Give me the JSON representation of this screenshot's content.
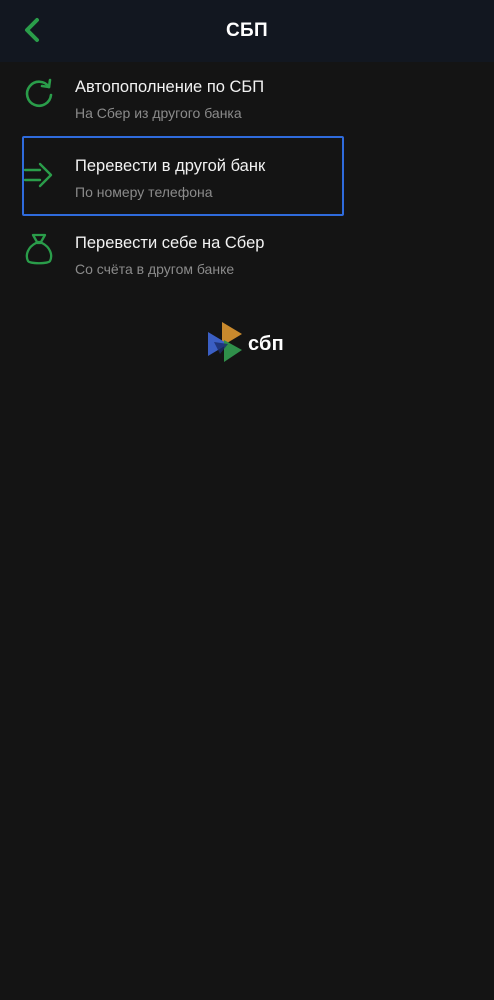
{
  "header": {
    "title": "СБП",
    "back_icon": "chevron-left-icon"
  },
  "menu": {
    "items": [
      {
        "title": "Автопополнение по СБП",
        "subtitle": "На Сбер из другого банка",
        "icon": "refresh-icon"
      },
      {
        "title": "Перевести в другой банк",
        "subtitle": "По номеру телефона",
        "icon": "transfer-arrow-icon"
      },
      {
        "title": "Перевести себе на Сбер",
        "subtitle": "Со счёта в другом банке",
        "icon": "money-bag-icon"
      }
    ]
  },
  "logo": {
    "text": "сбп",
    "icon": "sbp-logo-icon"
  },
  "colors": {
    "accent_green": "#2a9d4a",
    "focus_blue": "#2f6bdc",
    "background": "#141414",
    "header_background": "#121720",
    "subtitle_gray": "#8b8b8b"
  }
}
